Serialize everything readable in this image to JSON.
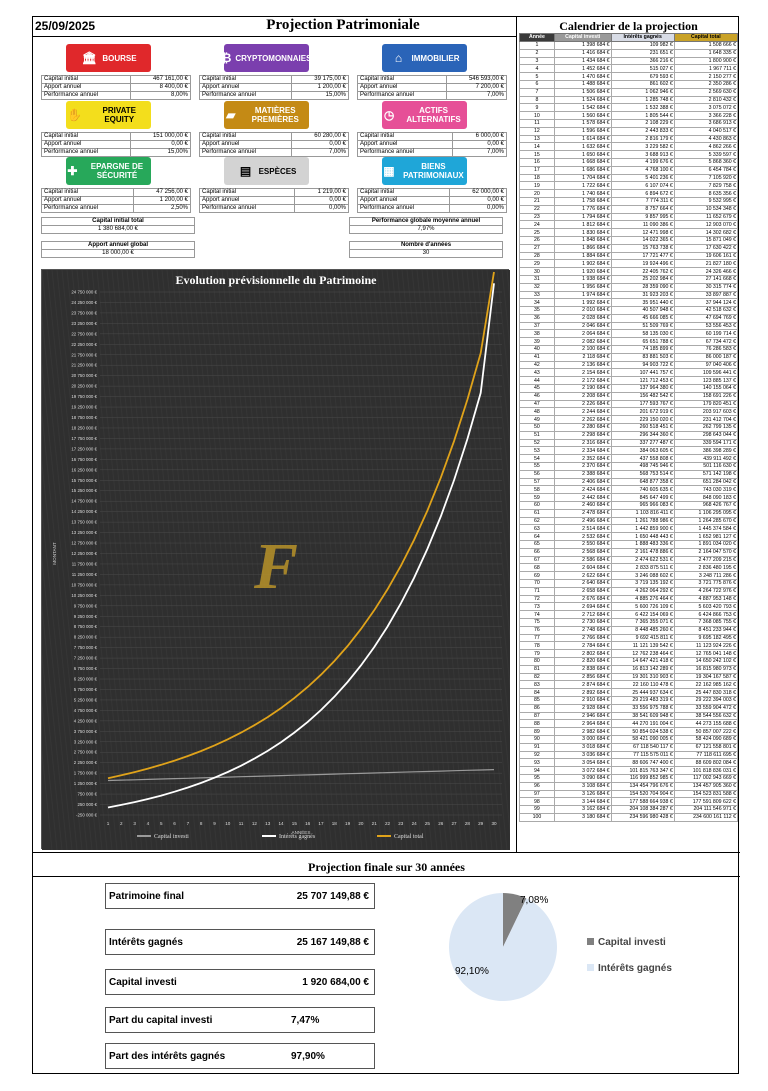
{
  "header": {
    "date": "25/09/2025",
    "title": "Projection Patrimoniale"
  },
  "labels": {
    "capital_initial": "Capital initial",
    "apport_annuel": "Apport annuel",
    "performance_annuel": "Performance annuel"
  },
  "assets": [
    {
      "name": "BOURSE",
      "icon": "bank-icon",
      "color": "#e0282b",
      "capital": "467 161,00 €",
      "apport": "8 400,00 €",
      "perf": "8,00%"
    },
    {
      "name": "CRYPTOMONNAIES",
      "icon": "bitcoin-icon",
      "color": "#7b3fae",
      "capital": "39 175,00 €",
      "apport": "1 200,00 €",
      "perf": "15,00%"
    },
    {
      "name": "IMMOBILIER",
      "icon": "house-icon",
      "color": "#2a64b8",
      "capital": "546 593,00 €",
      "apport": "7 200,00 €",
      "perf": "7,00%"
    },
    {
      "name": "PRIVATE EQUITY",
      "icon": "handshake-icon",
      "color": "#f3de1c",
      "capital": "151 000,00 €",
      "apport": "0,00 €",
      "perf": "15,00%"
    },
    {
      "name": "MATIÈRES PREMIÈRES",
      "icon": "gold-bars-icon",
      "color": "#c48a15",
      "capital": "60 280,00 €",
      "apport": "0,00 €",
      "perf": "7,00%"
    },
    {
      "name": "ACTIFS ALTERNATIFS",
      "icon": "watch-icon",
      "color": "#e64f97",
      "capital": "6 000,00 €",
      "apport": "0,00 €",
      "perf": "7,00%"
    },
    {
      "name": "EPARGNE DE SÉCURITÉ",
      "icon": "shield-icon",
      "color": "#27a85a",
      "capital": "47 256,00 €",
      "apport": "1 200,00 €",
      "perf": "2,50%"
    },
    {
      "name": "ESPÈCES",
      "icon": "cash-icon",
      "color": "#d3d3d3",
      "capital": "1 219,00 €",
      "apport": "0,00 €",
      "perf": "0,00%"
    },
    {
      "name": "BIENS PATRIMONIAUX",
      "icon": "building-icon",
      "color": "#1fa6d8",
      "capital": "62 000,00 €",
      "apport": "0,00 €",
      "perf": "0,00%"
    }
  ],
  "summary": {
    "capital_total_label": "Capital initial total",
    "capital_total": "1 380 684,00 €",
    "perf_label": "Performance globale moyenne annuel",
    "perf": "7,97%",
    "apport_label": "Apport annuel global",
    "apport": "18 000,00 €",
    "annees_label": "Nombre d'années",
    "annees": "30"
  },
  "chart_data": {
    "type": "line",
    "title": "Evolution prévisionnelle du Patrimoine",
    "xlabel": "ANNÉES",
    "ylabel": "MONTANT",
    "x": [
      1,
      2,
      3,
      4,
      5,
      6,
      7,
      8,
      9,
      10,
      11,
      12,
      13,
      14,
      15,
      16,
      17,
      18,
      19,
      20,
      21,
      22,
      23,
      24,
      25,
      26,
      27,
      28,
      29,
      30
    ],
    "ylim": [
      -250000,
      24750000
    ],
    "yticks": [
      "-250 000 €",
      "250 000 €",
      "750 000 €",
      "1 250 000 €",
      "1 750 000 €",
      "2 250 000 €",
      "2 750 000 €",
      "3 250 000 €",
      "3 750 000 €",
      "4 250 000 €",
      "4 750 000 €",
      "5 250 000 €",
      "5 750 000 €",
      "6 250 000 €",
      "6 750 000 €",
      "7 250 000 €",
      "7 750 000 €",
      "8 250 000 €",
      "8 750 000 €",
      "9 250 000 €",
      "9 750 000 €",
      "10 250 000 €",
      "10 750 000 €",
      "11 250 000 €",
      "11 750 000 €",
      "12 250 000 €",
      "12 750 000 €",
      "13 250 000 €",
      "13 750 000 €",
      "14 250 000 €",
      "14 750 000 €",
      "15 250 000 €",
      "15 750 000 €",
      "16 250 000 €",
      "16 750 000 €",
      "17 250 000 €",
      "17 750 000 €",
      "18 250 000 €",
      "18 750 000 €",
      "19 250 000 €",
      "19 750 000 €",
      "20 250 000 €",
      "20 750 000 €",
      "21 250 000 €",
      "21 750 000 €",
      "22 250 000 €",
      "22 750 000 €",
      "23 250 000 €",
      "23 750 000 €",
      "24 250 000 €",
      "24 750 000 €"
    ],
    "series": [
      {
        "name": "Capital investi",
        "color": "#9a9a9a",
        "values": [
          1398684,
          1416684,
          1434684,
          1452684,
          1470684,
          1488684,
          1506684,
          1524684,
          1542684,
          1560684,
          1578684,
          1596684,
          1614684,
          1632684,
          1650684,
          1668684,
          1686684,
          1704684,
          1722684,
          1740684,
          1758684,
          1776684,
          1794684,
          1812684,
          1830684,
          1848684,
          1866684,
          1884684,
          1902684,
          1920684
        ]
      },
      {
        "name": "Intérêts gagnés",
        "color": "#ffffff",
        "values": [
          109982,
          231651,
          366216,
          515027,
          679593,
          861602,
          1062946,
          1285748,
          1532388,
          1805544,
          2108229,
          2443833,
          2816179,
          3229582,
          3688913,
          4199676,
          4768100,
          5401236,
          6107074,
          6894672,
          7774311,
          8757664,
          9857995,
          11090386,
          12471998,
          14022365,
          15763738,
          17721477,
          19924496,
          25167150
        ]
      },
      {
        "name": "Capital total",
        "color": "#e0a31a",
        "values": [
          1508666,
          1648335,
          1800900,
          1967711,
          2150277,
          2350286,
          2569630,
          2810432,
          3075072,
          3366228,
          3686913,
          4040517,
          4430863,
          4862266,
          5339597,
          5868360,
          6454784,
          7105920,
          7829758,
          8635356,
          9532995,
          10534348,
          11652679,
          12903070,
          14302682,
          15871049,
          17630422,
          19606161,
          21827180,
          25707150
        ]
      }
    ]
  },
  "calendar": {
    "title": "Calendrier de la projection",
    "headers": [
      "Année",
      "Capital investi",
      "Intérêts gagnés",
      "Capital total"
    ],
    "rows": [
      [
        "1",
        "1 398 684 €",
        "109 982 €",
        "1 508 666 €"
      ],
      [
        "2",
        "1 416 684 €",
        "231 651 €",
        "1 648 335 €"
      ],
      [
        "3",
        "1 434 684 €",
        "366 216 €",
        "1 800 900 €"
      ],
      [
        "4",
        "1 452 684 €",
        "515 027 €",
        "1 967 711 €"
      ],
      [
        "5",
        "1 470 684 €",
        "679 593 €",
        "2 150 277 €"
      ],
      [
        "6",
        "1 488 684 €",
        "861 602 €",
        "2 350 286 €"
      ],
      [
        "7",
        "1 506 684 €",
        "1 062 946 €",
        "2 569 630 €"
      ],
      [
        "8",
        "1 524 684 €",
        "1 285 748 €",
        "2 810 432 €"
      ],
      [
        "9",
        "1 542 684 €",
        "1 532 388 €",
        "3 075 072 €"
      ],
      [
        "10",
        "1 560 684 €",
        "1 805 544 €",
        "3 366 228 €"
      ],
      [
        "11",
        "1 578 684 €",
        "2 108 229 €",
        "3 686 913 €"
      ],
      [
        "12",
        "1 596 684 €",
        "2 443 833 €",
        "4 040 517 €"
      ],
      [
        "13",
        "1 614 684 €",
        "2 816 179 €",
        "4 430 863 €"
      ],
      [
        "14",
        "1 632 684 €",
        "3 229 582 €",
        "4 862 266 €"
      ],
      [
        "15",
        "1 650 684 €",
        "3 688 913 €",
        "5 339 597 €"
      ],
      [
        "16",
        "1 668 684 €",
        "4 199 676 €",
        "5 868 360 €"
      ],
      [
        "17",
        "1 686 684 €",
        "4 768 100 €",
        "6 454 784 €"
      ],
      [
        "18",
        "1 704 684 €",
        "5 401 236 €",
        "7 105 920 €"
      ],
      [
        "19",
        "1 722 684 €",
        "6 107 074 €",
        "7 829 758 €"
      ],
      [
        "20",
        "1 740 684 €",
        "6 894 672 €",
        "8 635 356 €"
      ],
      [
        "21",
        "1 758 684 €",
        "7 774 311 €",
        "9 532 995 €"
      ],
      [
        "22",
        "1 776 684 €",
        "8 757 664 €",
        "10 534 348 €"
      ],
      [
        "23",
        "1 794 684 €",
        "9 857 995 €",
        "11 652 679 €"
      ],
      [
        "24",
        "1 812 684 €",
        "11 090 386 €",
        "12 903 070 €"
      ],
      [
        "25",
        "1 830 684 €",
        "12 471 998 €",
        "14 302 682 €"
      ],
      [
        "26",
        "1 848 684 €",
        "14 022 365 €",
        "15 871 049 €"
      ],
      [
        "27",
        "1 866 684 €",
        "15 763 738 €",
        "17 630 422 €"
      ],
      [
        "28",
        "1 884 684 €",
        "17 721 477 €",
        "19 606 161 €"
      ],
      [
        "29",
        "1 902 684 €",
        "19 924 496 €",
        "21 827 180 €"
      ],
      [
        "30",
        "1 920 684 €",
        "22 405 762 €",
        "24 326 466 €"
      ],
      [
        "31",
        "1 938 684 €",
        "25 202 984 €",
        "27 141 668 €"
      ],
      [
        "32",
        "1 956 684 €",
        "28 359 090 €",
        "30 315 774 €"
      ],
      [
        "33",
        "1 974 684 €",
        "31 923 203 €",
        "33 897 887 €"
      ],
      [
        "34",
        "1 992 684 €",
        "35 951 440 €",
        "37 944 124 €"
      ],
      [
        "35",
        "2 010 684 €",
        "40 507 948 €",
        "42 518 632 €"
      ],
      [
        "36",
        "2 028 684 €",
        "45 666 085 €",
        "47 694 769 €"
      ],
      [
        "37",
        "2 046 684 €",
        "51 509 769 €",
        "53 556 453 €"
      ],
      [
        "38",
        "2 064 684 €",
        "58 135 030 €",
        "60 199 714 €"
      ],
      [
        "39",
        "2 082 684 €",
        "65 651 788 €",
        "67 734 472 €"
      ],
      [
        "40",
        "2 100 684 €",
        "74 185 899 €",
        "76 286 583 €"
      ],
      [
        "41",
        "2 118 684 €",
        "83 881 503 €",
        "86 000 187 €"
      ],
      [
        "42",
        "2 136 684 €",
        "94 903 722 €",
        "97 040 406 €"
      ],
      [
        "43",
        "2 154 684 €",
        "107 441 757 €",
        "109 596 441 €"
      ],
      [
        "44",
        "2 172 684 €",
        "121 712 453 €",
        "123 885 137 €"
      ],
      [
        "45",
        "2 190 684 €",
        "137 964 380 €",
        "140 155 064 €"
      ],
      [
        "46",
        "2 208 684 €",
        "156 482 542 €",
        "158 691 226 €"
      ],
      [
        "47",
        "2 226 684 €",
        "177 593 767 €",
        "179 820 451 €"
      ],
      [
        "48",
        "2 244 684 €",
        "201 672 919 €",
        "203 917 603 €"
      ],
      [
        "49",
        "2 262 684 €",
        "229 150 020 €",
        "231 412 704 €"
      ],
      [
        "50",
        "2 280 684 €",
        "260 518 451 €",
        "262 799 135 €"
      ],
      [
        "51",
        "2 298 684 €",
        "296 344 360 €",
        "298 643 044 €"
      ],
      [
        "52",
        "2 316 684 €",
        "337 277 487 €",
        "339 594 171 €"
      ],
      [
        "53",
        "2 334 684 €",
        "384 063 605 €",
        "386 398 289 €"
      ],
      [
        "54",
        "2 352 684 €",
        "437 558 808 €",
        "439 911 492 €"
      ],
      [
        "55",
        "2 370 684 €",
        "498 745 946 €",
        "501 116 630 €"
      ],
      [
        "56",
        "2 388 684 €",
        "568 753 514 €",
        "571 142 198 €"
      ],
      [
        "57",
        "2 406 684 €",
        "648 877 358 €",
        "651 284 042 €"
      ],
      [
        "58",
        "2 424 684 €",
        "740 605 635 €",
        "743 030 319 €"
      ],
      [
        "59",
        "2 442 684 €",
        "845 647 499 €",
        "848 090 183 €"
      ],
      [
        "60",
        "2 460 684 €",
        "965 966 083 €",
        "968 426 767 €"
      ],
      [
        "61",
        "2 478 684 €",
        "1 103 816 411 €",
        "1 106 295 095 €"
      ],
      [
        "62",
        "2 496 684 €",
        "1 261 788 986 €",
        "1 264 285 670 €"
      ],
      [
        "63",
        "2 514 684 €",
        "1 442 859 900 €",
        "1 445 374 584 €"
      ],
      [
        "64",
        "2 532 684 €",
        "1 650 448 443 €",
        "1 652 981 127 €"
      ],
      [
        "65",
        "2 550 684 €",
        "1 888 483 336 €",
        "1 891 034 020 €"
      ],
      [
        "66",
        "2 568 684 €",
        "2 161 478 886 €",
        "2 164 047 570 €"
      ],
      [
        "67",
        "2 586 684 €",
        "2 474 622 531 €",
        "2 477 209 215 €"
      ],
      [
        "68",
        "2 604 684 €",
        "2 833 875 511 €",
        "2 836 480 195 €"
      ],
      [
        "69",
        "2 622 684 €",
        "3 246 088 602 €",
        "3 248 711 286 €"
      ],
      [
        "70",
        "2 640 684 €",
        "3 719 135 192 €",
        "3 721 775 876 €"
      ],
      [
        "71",
        "2 658 684 €",
        "4 262 064 292 €",
        "4 264 722 976 €"
      ],
      [
        "72",
        "2 676 684 €",
        "4 885 276 464 €",
        "4 887 953 148 €"
      ],
      [
        "73",
        "2 694 684 €",
        "5 600 726 109 €",
        "5 603 420 793 €"
      ],
      [
        "74",
        "2 712 684 €",
        "6 422 154 069 €",
        "6 424 866 753 €"
      ],
      [
        "75",
        "2 730 684 €",
        "7 365 355 071 €",
        "7 368 085 755 €"
      ],
      [
        "76",
        "2 748 684 €",
        "8 448 485 260 €",
        "8 451 233 944 €"
      ],
      [
        "77",
        "2 766 684 €",
        "9 692 415 811 €",
        "9 695 182 495 €"
      ],
      [
        "78",
        "2 784 684 €",
        "11 121 139 542 €",
        "11 123 924 226 €"
      ],
      [
        "79",
        "2 802 684 €",
        "12 762 238 464 €",
        "12 765 041 148 €"
      ],
      [
        "80",
        "2 820 684 €",
        "14 647 421 418 €",
        "14 650 242 102 €"
      ],
      [
        "81",
        "2 838 684 €",
        "16 813 142 289 €",
        "16 815 980 973 €"
      ],
      [
        "82",
        "2 856 684 €",
        "19 301 310 903 €",
        "19 304 167 587 €"
      ],
      [
        "83",
        "2 874 684 €",
        "22 160 110 478 €",
        "22 162 985 162 €"
      ],
      [
        "84",
        "2 892 684 €",
        "25 444 937 634 €",
        "25 447 830 318 €"
      ],
      [
        "85",
        "2 910 684 €",
        "29 219 483 319 €",
        "29 222 394 003 €"
      ],
      [
        "86",
        "2 928 684 €",
        "33 556 975 788 €",
        "33 559 904 472 €"
      ],
      [
        "87",
        "2 946 684 €",
        "38 541 609 948 €",
        "38 544 556 632 €"
      ],
      [
        "88",
        "2 964 684 €",
        "44 270 191 004 €",
        "44 273 155 688 €"
      ],
      [
        "89",
        "2 982 684 €",
        "50 854 024 538 €",
        "50 857 007 222 €"
      ],
      [
        "90",
        "3 000 684 €",
        "58 421 090 005 €",
        "58 424 090 689 €"
      ],
      [
        "91",
        "3 018 684 €",
        "67 118 540 117 €",
        "67 121 558 801 €"
      ],
      [
        "92",
        "3 036 684 €",
        "77 115 575 011 €",
        "77 118 611 695 €"
      ],
      [
        "93",
        "3 054 684 €",
        "88 606 747 400 €",
        "88 609 802 084 €"
      ],
      [
        "94",
        "3 072 684 €",
        "101 815 763 347 €",
        "101 818 836 031 €"
      ],
      [
        "95",
        "3 090 684 €",
        "116 999 852 985 €",
        "117 002 943 669 €"
      ],
      [
        "96",
        "3 108 684 €",
        "134 454 796 676 €",
        "134 457 905 360 €"
      ],
      [
        "97",
        "3 126 684 €",
        "154 520 704 904 €",
        "154 523 831 588 €"
      ],
      [
        "98",
        "3 144 684 €",
        "177 588 664 938 €",
        "177 591 809 622 €"
      ],
      [
        "99",
        "3 162 684 €",
        "204 108 384 287 €",
        "204 111 546 971 €"
      ],
      [
        "100",
        "3 180 684 €",
        "234 596 980 428 €",
        "234 600 161 112 €"
      ]
    ]
  },
  "final": {
    "title": "Projection finale sur 30 années",
    "rows": [
      {
        "label": "Patrimoine final",
        "value": "25 707 149,88 €"
      },
      {
        "label": "Intérêts gagnés",
        "value": "25 167 149,88 €"
      },
      {
        "label": "Capital investi",
        "value": "1 920 684,00 €"
      },
      {
        "label": "Part du capital investi",
        "value": "7,47%"
      },
      {
        "label": "Part des intérêts gagnés",
        "value": "97,90%"
      }
    ],
    "pie": {
      "slices": [
        {
          "name": "Capital investi",
          "pct": 7.08,
          "label": "7,08%",
          "color": "#808080"
        },
        {
          "name": "Intérêts gagnés",
          "pct": 92.1,
          "label": "92,10%",
          "color": "#dbe7f5"
        }
      ]
    }
  }
}
